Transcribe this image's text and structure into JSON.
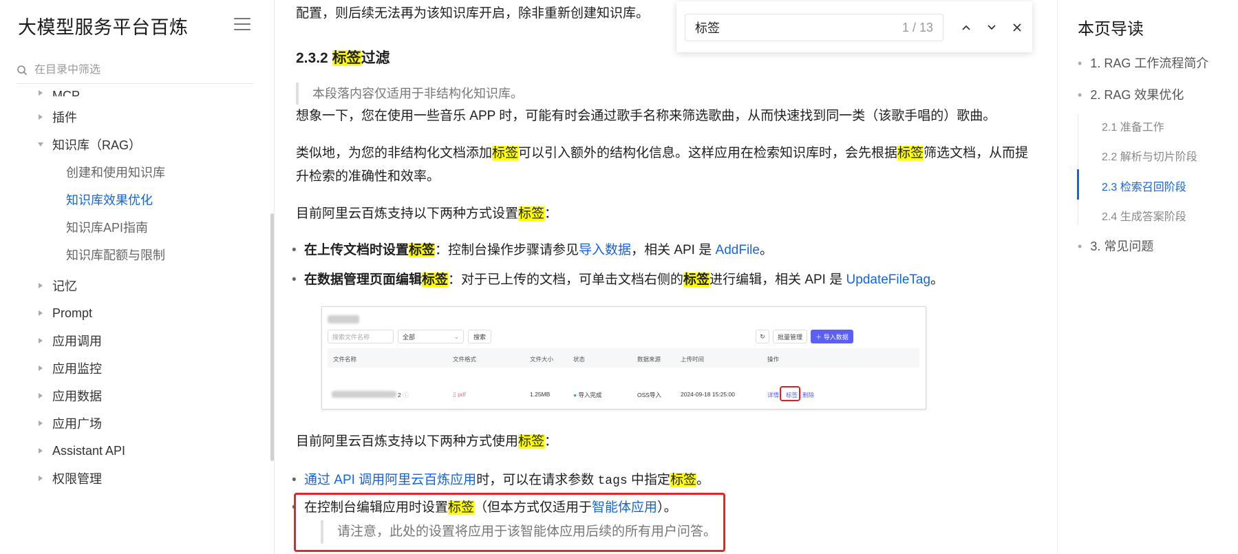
{
  "sidebar": {
    "title": "大模型服务平台百炼",
    "search_placeholder": "在目录中筛选",
    "cut_item": "MCP",
    "items": [
      {
        "label": "插件"
      },
      {
        "label": "知识库（RAG）"
      },
      {
        "label": "记忆"
      },
      {
        "label": "Prompt"
      },
      {
        "label": "应用调用"
      },
      {
        "label": "应用监控"
      },
      {
        "label": "应用数据"
      },
      {
        "label": "应用广场"
      },
      {
        "label": "Assistant API"
      },
      {
        "label": "权限管理"
      }
    ],
    "sub_items": [
      {
        "label": "创建和使用知识库"
      },
      {
        "label": "知识库效果优化"
      },
      {
        "label": "知识库API指南"
      },
      {
        "label": "知识库配额与限制"
      }
    ]
  },
  "content": {
    "context_line": "配置，则后续无法再为该知识库开启，除非重新创建知识库。",
    "heading_num": "2.3.2",
    "heading_hl": "标签",
    "heading_rest": "过滤",
    "quote": "本段落内容仅适用于非结构化知识库。",
    "p1": "想象一下，您在使用一些音乐 APP 时，可能有时会通过歌手名称来筛选歌曲，从而快速找到同一类（该歌手唱的）歌曲。",
    "p2_a": "类似地，为您的非结构化文档添加",
    "p2_b": "可以引入额外的结构化信息。这样应用在检索知识库时，会先根据",
    "p2_c": "筛选文档，从而提升检索的准确性和效率。",
    "kw": "标签",
    "p3": "目前阿里云百炼支持以下两种方式设置",
    "b1_bold": "在上传文档时设置",
    "b1_a": "：控制台操作步骤请参见",
    "b1_link": "导入数据",
    "b1_b": "，相关 API 是 ",
    "b1_api": "AddFile",
    "b2_bold": "在数据管理页面编辑",
    "b2_a": "：对于已上传的文档，可单击文档右侧的",
    "b2_b": "进行编辑，相关 API 是 ",
    "b2_api": "UpdateFileTag",
    "p4": "目前阿里云百炼支持以下两种方式使用",
    "b3_link": "通过 API 调用阿里云百炼应用",
    "b3_a": "时，可以在请求参数 ",
    "b3_code": "tags",
    "b3_b": " 中指定",
    "b4_a": "在控制台编辑应用时设置",
    "b4_b": "（但本方式仅适用于",
    "b4_link": "智能体应用",
    "b4_c": "）。",
    "note": "请注意，此处的设置将应用于该智能体应用后续的所有用户问答。",
    "colon": "：",
    "period": "。"
  },
  "embedded_screenshot": {
    "search_placeholder": "搜索文件名称",
    "filter_value": "全部",
    "search_btn": "搜索",
    "batch_btn": "批量管理",
    "import_btn": "导入数据",
    "headers": [
      "文件名称",
      "文件格式",
      "文件大小",
      "状态",
      "数据来源",
      "上传时间",
      "操作"
    ],
    "row": {
      "name_suffix": "2",
      "format": "pdf",
      "size": "1.25MB",
      "status": "导入完成",
      "source": "OSS导入",
      "time": "2024-09-18 15:25:00",
      "op_detail": "详情",
      "op_tag": "标签",
      "op_delete": "删除"
    }
  },
  "findbar": {
    "query": "标签",
    "counter": "1  /  13"
  },
  "toc": {
    "title": "本页导读",
    "items": [
      {
        "label": "1. RAG 工作流程简介"
      },
      {
        "label": "2. RAG 效果优化"
      },
      {
        "label": "3. 常见问题"
      }
    ],
    "sub_items": [
      {
        "label": "2.1 准备工作"
      },
      {
        "label": "2.2 解析与切片阶段"
      },
      {
        "label": "2.3 检索召回阶段"
      },
      {
        "label": "2.4 生成答案阶段"
      }
    ]
  },
  "colors": {
    "link": "#1565e0",
    "highlight": "#ffff00",
    "annotation_red": "#e8232a",
    "primary_button": "#5b5ff5"
  }
}
